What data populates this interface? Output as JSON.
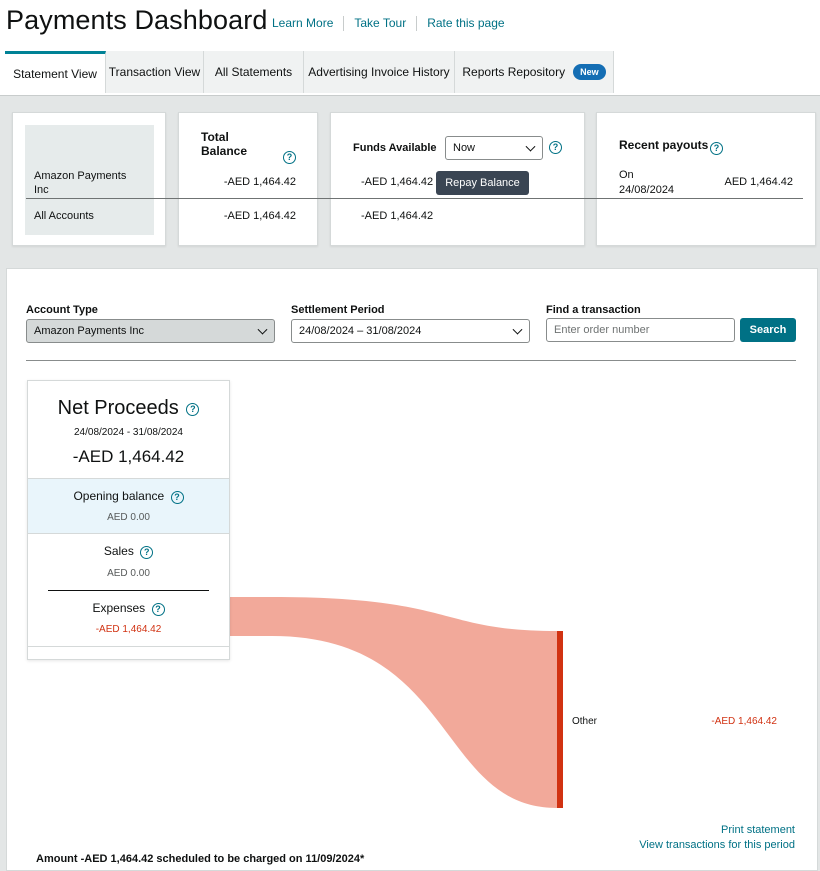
{
  "header": {
    "title": "Payments Dashboard",
    "links": [
      "Learn More",
      "Take Tour",
      "Rate this page"
    ]
  },
  "tabs": [
    {
      "label": "Statement View",
      "active": true
    },
    {
      "label": "Transaction View",
      "active": false
    },
    {
      "label": "All Statements",
      "active": false
    },
    {
      "label": "Advertising Invoice History",
      "active": false
    },
    {
      "label": "Reports Repository",
      "active": false,
      "badge": "New"
    }
  ],
  "summary": {
    "accounts": [
      "Amazon Payments Inc",
      "All Accounts"
    ],
    "total_balance": {
      "label": "Total Balance",
      "values": [
        "-AED 1,464.42",
        "-AED 1,464.42"
      ]
    },
    "funds_available": {
      "label": "Funds Available",
      "select_value": "Now",
      "values": [
        "-AED 1,464.42",
        "-AED 1,464.42"
      ],
      "repay_label": "Repay Balance"
    },
    "recent_payouts": {
      "label": "Recent payouts",
      "on_label": "On",
      "date": "24/08/2024",
      "amount": "AED 1,464.42"
    }
  },
  "filters": {
    "account_type_label": "Account Type",
    "account_type_value": "Amazon Payments Inc",
    "settlement_period_label": "Settlement Period",
    "settlement_period_value": "24/08/2024 – 31/08/2024",
    "find_label": "Find a transaction",
    "find_placeholder": "Enter order number",
    "search_label": "Search"
  },
  "net_proceeds": {
    "title": "Net Proceeds",
    "period": "24/08/2024 - 31/08/2024",
    "amount": "-AED 1,464.42",
    "opening_balance": {
      "label": "Opening balance",
      "value": "AED 0.00"
    },
    "sales": {
      "label": "Sales",
      "value": "AED 0.00"
    },
    "expenses": {
      "label": "Expenses",
      "value": "-AED 1,464.42"
    }
  },
  "flow": {
    "target_label": "Other",
    "target_value": "-AED 1,464.42",
    "colors": {
      "flow": "#f2a99a",
      "bar": "#d13212",
      "negative": "#d13212"
    }
  },
  "footer": {
    "print_label": "Print statement",
    "view_label": "View transactions for this period",
    "note": "Amount -AED 1,464.42 scheduled to be charged on 11/09/2024*"
  }
}
